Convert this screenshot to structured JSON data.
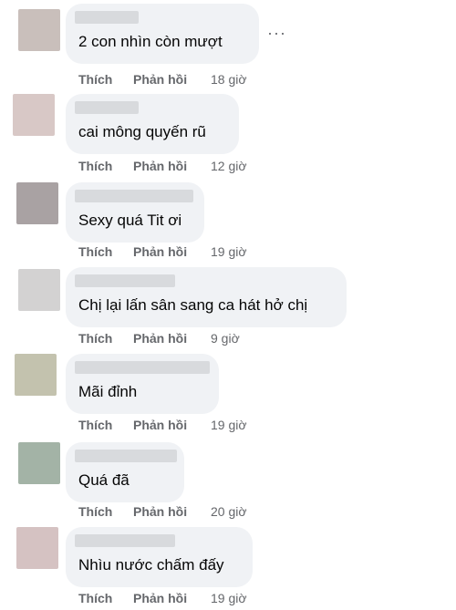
{
  "actions": {
    "like": "Thích",
    "reply": "Phản hồi"
  },
  "more_options": "···",
  "comments": [
    {
      "text": "2 con nhìn còn mượt",
      "time": "18 giờ",
      "avatar_color": "#c9bfbb"
    },
    {
      "text": "cai mông quyến rũ",
      "time": "12 giờ",
      "avatar_color": "#d8c8c6"
    },
    {
      "text": "Sexy quá Tit ơi",
      "time": "19 giờ",
      "avatar_color": "#a9a2a3"
    },
    {
      "text": "Chị lại lấn sân sang ca hát hở chị",
      "time": "9 giờ",
      "avatar_color": "#d3d2d2"
    },
    {
      "text": "Mãi đỉnh",
      "time": "19 giờ",
      "avatar_color": "#c3c2ae"
    },
    {
      "text": "Quá đã",
      "time": "20 giờ",
      "avatar_color": "#a3b3a6"
    },
    {
      "text": "Nhìu nước chấm đấy",
      "time": "19 giờ",
      "avatar_color": "#d5c2c2"
    }
  ]
}
